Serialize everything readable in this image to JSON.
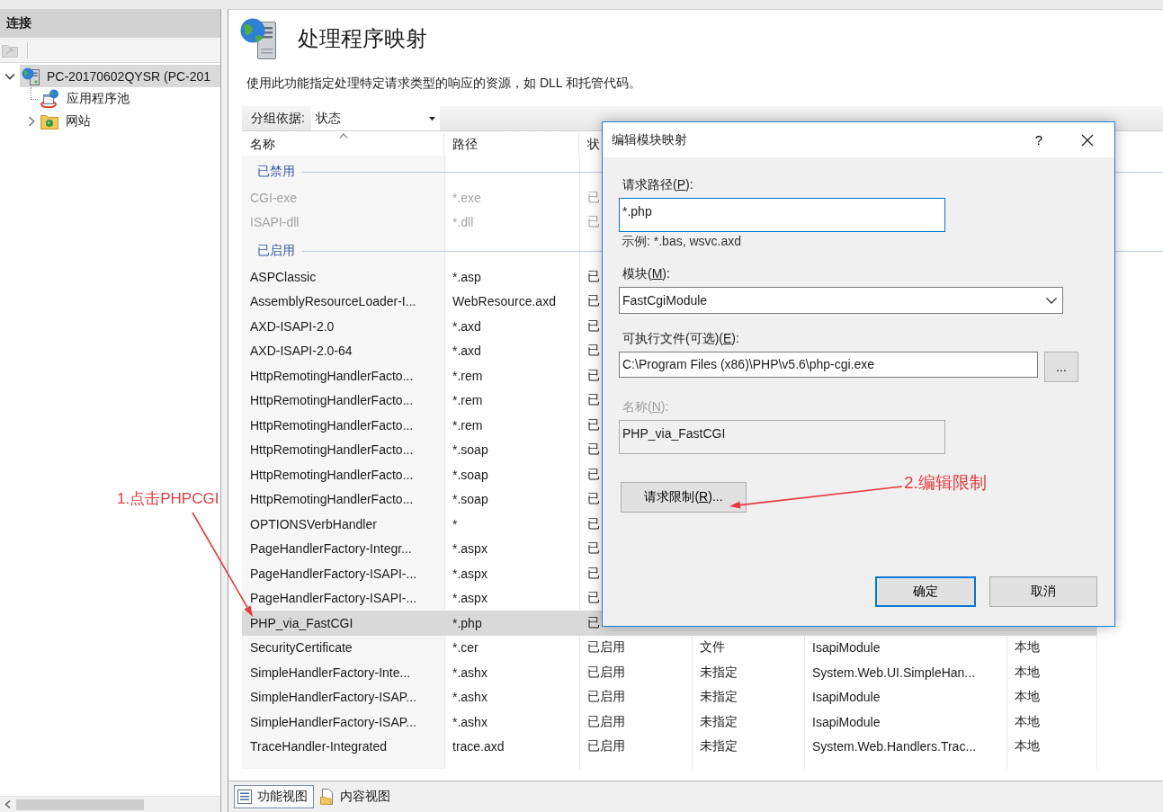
{
  "connections": {
    "title": "连接",
    "tree": [
      {
        "label": "PC-20170602QYSR (PC-201",
        "kind": "server",
        "expanded": true,
        "selected": true,
        "children": [
          {
            "label": "应用程序池",
            "kind": "app-pools",
            "selected": false
          },
          {
            "label": "网站",
            "kind": "sites",
            "expanded": false,
            "selected": false
          }
        ]
      }
    ]
  },
  "feature": {
    "title": "处理程序映射",
    "description": "使用此功能指定处理特定请求类型的响应的资源，如 DLL 和托管代码。"
  },
  "group_by": {
    "label": "分组依据:",
    "value": "状态"
  },
  "table": {
    "columns": [
      {
        "label": "名称",
        "sorted": true
      },
      {
        "label": "路径",
        "sorted": false
      },
      {
        "label": "状",
        "sorted": false
      }
    ],
    "groups": [
      {
        "label": "已禁用",
        "rows": [
          {
            "cells": [
              "CGI-exe",
              "*.exe",
              "已"
            ],
            "disabled": true,
            "selected": false
          },
          {
            "cells": [
              "ISAPI-dll",
              "*.dll",
              "已"
            ],
            "disabled": true,
            "selected": false
          }
        ]
      },
      {
        "label": "已启用",
        "rows": [
          {
            "cells": [
              "ASPClassic",
              "*.asp",
              "已"
            ],
            "disabled": false,
            "selected": false
          },
          {
            "cells": [
              "AssemblyResourceLoader-I...",
              "WebResource.axd",
              "已"
            ],
            "disabled": false,
            "selected": false
          },
          {
            "cells": [
              "AXD-ISAPI-2.0",
              "*.axd",
              "已"
            ],
            "disabled": false,
            "selected": false
          },
          {
            "cells": [
              "AXD-ISAPI-2.0-64",
              "*.axd",
              "已"
            ],
            "disabled": false,
            "selected": false
          },
          {
            "cells": [
              "HttpRemotingHandlerFacto...",
              "*.rem",
              "已"
            ],
            "disabled": false,
            "selected": false
          },
          {
            "cells": [
              "HttpRemotingHandlerFacto...",
              "*.rem",
              "已"
            ],
            "disabled": false,
            "selected": false
          },
          {
            "cells": [
              "HttpRemotingHandlerFacto...",
              "*.rem",
              "已"
            ],
            "disabled": false,
            "selected": false
          },
          {
            "cells": [
              "HttpRemotingHandlerFacto...",
              "*.soap",
              "已"
            ],
            "disabled": false,
            "selected": false
          },
          {
            "cells": [
              "HttpRemotingHandlerFacto...",
              "*.soap",
              "已"
            ],
            "disabled": false,
            "selected": false
          },
          {
            "cells": [
              "HttpRemotingHandlerFacto...",
              "*.soap",
              "已"
            ],
            "disabled": false,
            "selected": false
          },
          {
            "cells": [
              "OPTIONSVerbHandler",
              "*",
              "已"
            ],
            "disabled": false,
            "selected": false
          },
          {
            "cells": [
              "PageHandlerFactory-Integr...",
              "*.aspx",
              "已"
            ],
            "disabled": false,
            "selected": false
          },
          {
            "cells": [
              "PageHandlerFactory-ISAPI-...",
              "*.aspx",
              "已"
            ],
            "disabled": false,
            "selected": false
          },
          {
            "cells": [
              "PageHandlerFactory-ISAPI-...",
              "*.aspx",
              "已"
            ],
            "disabled": false,
            "selected": false
          },
          {
            "cells": [
              "PHP_via_FastCGI",
              "*.php",
              "已"
            ],
            "disabled": false,
            "selected": true
          },
          {
            "cells": [
              "SecurityCertificate",
              "*.cer",
              "已启用",
              "文件",
              "IsapiModule",
              "本地"
            ],
            "disabled": false,
            "selected": false
          },
          {
            "cells": [
              "SimpleHandlerFactory-Inte...",
              "*.ashx",
              "已启用",
              "未指定",
              "System.Web.UI.SimpleHan...",
              "本地"
            ],
            "disabled": false,
            "selected": false
          },
          {
            "cells": [
              "SimpleHandlerFactory-ISAP...",
              "*.ashx",
              "已启用",
              "未指定",
              "IsapiModule",
              "本地"
            ],
            "disabled": false,
            "selected": false
          },
          {
            "cells": [
              "SimpleHandlerFactory-ISAP...",
              "*.ashx",
              "已启用",
              "未指定",
              "IsapiModule",
              "本地"
            ],
            "disabled": false,
            "selected": false
          },
          {
            "cells": [
              "TraceHandler-Integrated",
              "trace.axd",
              "已启用",
              "未指定",
              "System.Web.Handlers.Trac...",
              "本地"
            ],
            "disabled": false,
            "selected": false
          }
        ]
      }
    ]
  },
  "views": [
    {
      "label": "功能视图",
      "kind": "features",
      "selected": true
    },
    {
      "label": "内容视图",
      "kind": "content",
      "selected": false
    }
  ],
  "dialog": {
    "title": "编辑模块映射",
    "help": "?",
    "fields": [
      {
        "kind": "text",
        "label": [
          "请求路径(",
          "P",
          "):"
        ],
        "value": "*.php",
        "hint": "示例: *.bas, wsvc.axd",
        "focused": true,
        "disabled": false
      },
      {
        "kind": "select",
        "label": [
          "模块(",
          "M",
          "):"
        ],
        "value": "FastCgiModule",
        "focused": false,
        "disabled": false
      },
      {
        "kind": "browse",
        "label": [
          "可执行文件(可选)(",
          "E",
          "):"
        ],
        "value": "C:\\Program Files (x86)\\PHP\\v5.6\\php-cgi.exe",
        "browse": "...",
        "focused": false,
        "disabled": false
      },
      {
        "kind": "text",
        "label": [
          "名称(",
          "N",
          "):"
        ],
        "value": "PHP_via_FastCGI",
        "focused": false,
        "disabled": true
      }
    ],
    "restrictions": [
      "请求限制(",
      "R",
      ")..."
    ],
    "buttons": [
      {
        "label": "确定",
        "default": true
      },
      {
        "label": "取消",
        "default": false
      }
    ]
  },
  "annotations": [
    {
      "text": "1.点击PHPCGI"
    },
    {
      "text": "2.编辑限制"
    }
  ]
}
